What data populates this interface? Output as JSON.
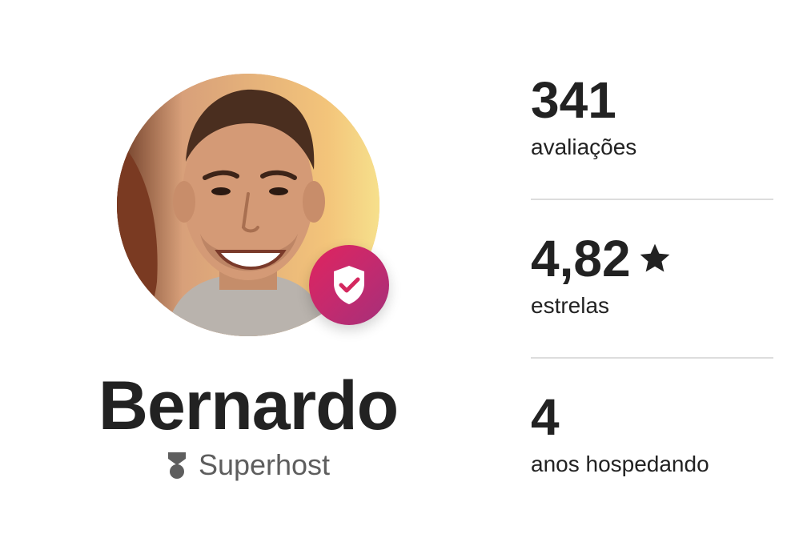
{
  "host": {
    "name": "Bernardo",
    "badge_label": "Superhost",
    "avatar_icon": "host-photo",
    "verified_icon": "shield-check-icon",
    "badge_icon": "superhost-medal-icon"
  },
  "stats": [
    {
      "value": "341",
      "label": "avaliações"
    },
    {
      "value": "4,82",
      "label": "estrelas",
      "icon": "star-icon"
    },
    {
      "value": "4",
      "label": "anos hospedando"
    }
  ],
  "colors": {
    "text": "#222222",
    "muted": "#5e5e5e",
    "badge_gradient_start": "#e0245e",
    "badge_gradient_end": "#a4307a",
    "divider": "#dddddd"
  }
}
